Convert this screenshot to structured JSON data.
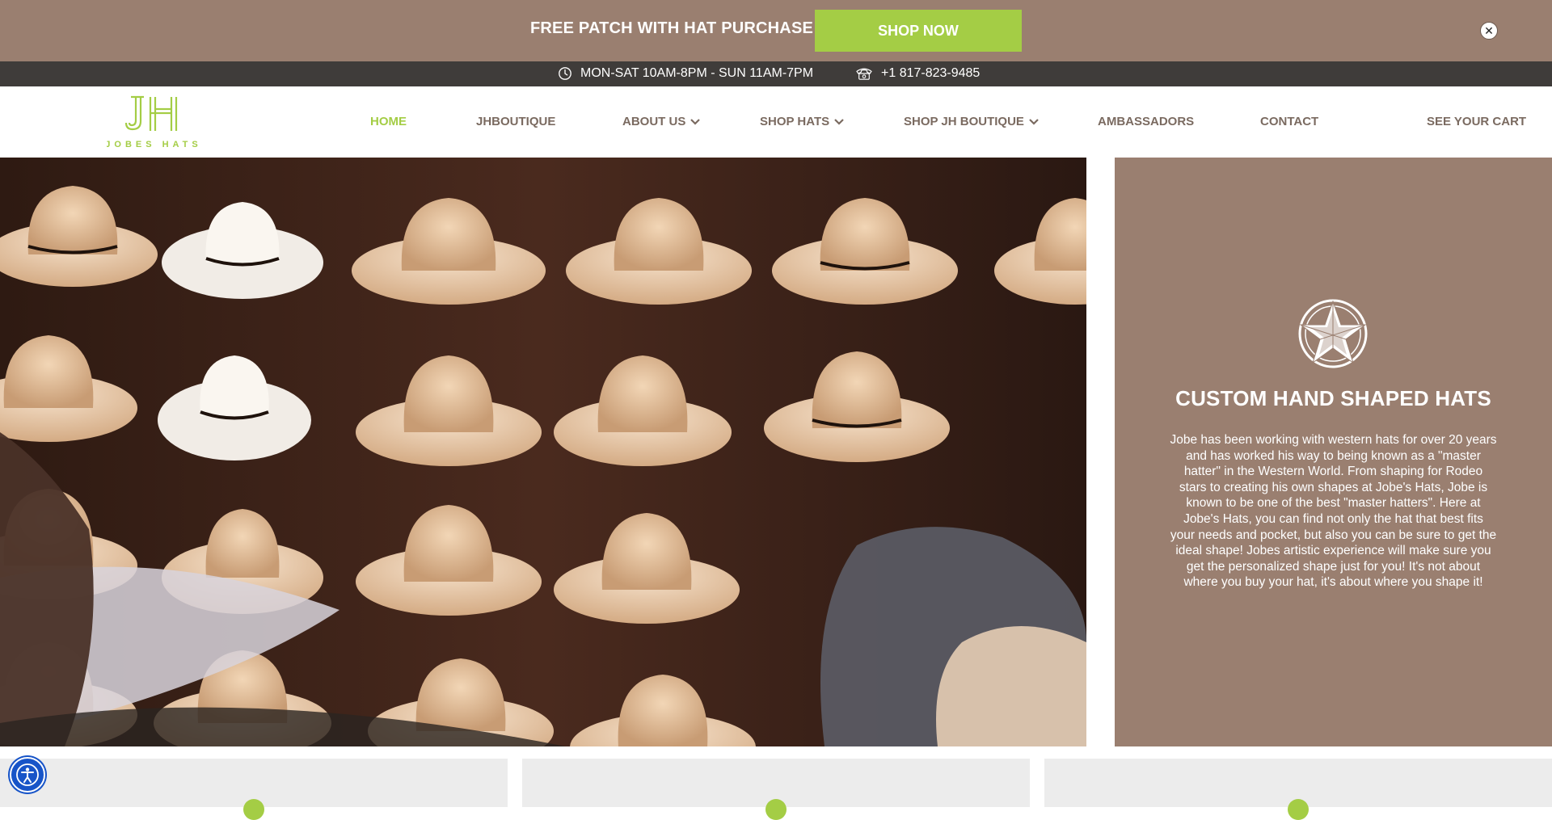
{
  "promo": {
    "text": "FREE PATCH WITH HAT PURCHASE",
    "button_label": "SHOP NOW",
    "close_glyph": "✕"
  },
  "infobar": {
    "hours": "MON-SAT 10AM-8PM - SUN 11AM-7PM",
    "phone": "+1 817-823-9485",
    "hours_icon": "clock-icon",
    "phone_icon": "phone-icon"
  },
  "logo": {
    "monogram": "JH",
    "wordmark": "JOBES HATS"
  },
  "nav": {
    "items": [
      {
        "label": "HOME",
        "active": true
      },
      {
        "label": "JHBOUTIQUE"
      },
      {
        "label": "ABOUT US",
        "dropdown": true
      },
      {
        "label": "SHOP HATS",
        "dropdown": true
      },
      {
        "label": "SHOP JH BOUTIQUE",
        "dropdown": true
      },
      {
        "label": "AMBASSADORS"
      },
      {
        "label": "CONTACT"
      },
      {
        "label": "SEE YOUR CART"
      }
    ]
  },
  "hero": {
    "image_alt": "wall of cowboy hats",
    "title": "CUSTOM HAND SHAPED HATS",
    "body": "Jobe has been working with western hats for over 20 years and has worked his way to being known as a \"master hatter\" in the Western World. From shaping for Rodeo stars to creating his own shapes at Jobe's Hats, Jobe is known to be one of the best \"master hatters\". Here at Jobe's Hats, you can find not only the hat that best fits your needs and pocket, but also you can be sure to get the ideal shape! Jobes artistic experience will make sure you get the personalized shape just for you! It's not about where you buy your hat, it's about where you shape it!"
  },
  "colors": {
    "brand_green": "#a4cd45",
    "brand_brown": "#9a7f70",
    "infobar_dark": "#3f3c3a",
    "nav_text": "#7a6a60",
    "accessibility_blue": "#1754c8"
  }
}
